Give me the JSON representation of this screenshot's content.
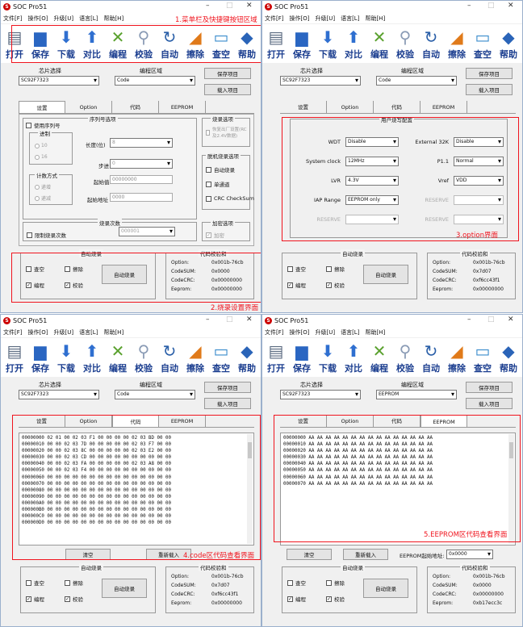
{
  "app": {
    "title": "SOC Pro51",
    "logo": "S"
  },
  "menu": [
    "文件[F]",
    "操作[O]",
    "升级[U]",
    "语言[L]",
    "帮助[H]"
  ],
  "toolbar": [
    {
      "label": "打开",
      "icon": "document-icon",
      "glyph": "▤",
      "color": "#5a6a80"
    },
    {
      "label": "保存",
      "icon": "floppy-icon",
      "glyph": "▆",
      "color": "#2a66c2"
    },
    {
      "label": "下载",
      "icon": "arrow-down-icon",
      "glyph": "⬇",
      "color": "#2f6fd0"
    },
    {
      "label": "对比",
      "icon": "arrow-up-icon",
      "glyph": "⬆",
      "color": "#2f6fd0"
    },
    {
      "label": "编程",
      "icon": "tools-icon",
      "glyph": "✕",
      "color": "#5aa12e"
    },
    {
      "label": "校验",
      "icon": "magnifier-icon",
      "glyph": "⚲",
      "color": "#8a9bb5"
    },
    {
      "label": "自动",
      "icon": "refresh-icon",
      "glyph": "↻",
      "color": "#2a5fa8"
    },
    {
      "label": "擦除",
      "icon": "eraser-icon",
      "glyph": "◢",
      "color": "#e07a1a"
    },
    {
      "label": "查空",
      "icon": "monitor-icon",
      "glyph": "▭",
      "color": "#3a8ccc"
    },
    {
      "label": "帮助",
      "icon": "help-icon",
      "glyph": "◆",
      "color": "#2a64b8"
    }
  ],
  "chip": {
    "label": "芯片选择",
    "value": "SC92F7323"
  },
  "region": {
    "label": "编程区域",
    "value_code": "Code",
    "value_eeprom": "EEPROM"
  },
  "buttons": {
    "save_project": "保存项目",
    "load_project": "载入项目",
    "clear": "清空",
    "reload": "重新载入",
    "auto_burn": "自动烧录"
  },
  "tabs": [
    "设置",
    "Option",
    "代码",
    "EEPROM"
  ],
  "settings": {
    "serial_check": "使用序列号",
    "base_label": "进制",
    "base_10": "10",
    "base_16": "16",
    "serial_options": "序列号选项",
    "length_label": "长度(位)",
    "length_value": "8",
    "step_label": "步进",
    "step_value": "0",
    "start_label": "起始值",
    "start_value": "00000000",
    "start_addr_label": "起始地址",
    "start_addr_value": "0000",
    "count_mode": "计数方式",
    "inc": "递增",
    "dec": "递减",
    "burn_options": "烧录选项",
    "burn_opt_text": "恢复出厂设置(RC 及2.4V数据)",
    "offline_options": "脱机烧录选项",
    "auto_burn_chk": "自动烧录",
    "single_ch": "单通道",
    "crc_chk": "CRC CheckSum",
    "burn_count": "烧录次数",
    "limit_count": "限制烧录次数",
    "count_value": "000001",
    "encrypt_options": "加密选项",
    "encrypt": "加密"
  },
  "option": {
    "title": "用户烧写配置",
    "wdt_label": "WDT",
    "wdt": "Disable",
    "ext_label": "External 32K",
    "ext": "Disable",
    "clk_label": "System clock",
    "clk": "12MHz",
    "p11_label": "P1.1",
    "p11": "Normal",
    "lvr_label": "LVR",
    "lvr": "4.3V",
    "vref_label": "Vref",
    "vref": "VDD",
    "iap_label": "IAP Range",
    "iap": "EEPROM only",
    "reserve": "RESERVE"
  },
  "auto_burn_group": {
    "title": "自动烧录",
    "blank": "查空",
    "erase": "擦除",
    "program": "编程",
    "verify": "校验"
  },
  "checksum_group": {
    "title": "代码校验和",
    "option_label": "Option:",
    "codesum_label": "CodeSUM:",
    "codecrc_label": "CodeCRC:",
    "eeprom_label": "Eeprom:",
    "w1": {
      "option": "0x001b-76cb",
      "codesum": "0x0000",
      "codecrc": "0x00000000",
      "eeprom": "0x00000000"
    },
    "w2": {
      "option": "0x001b-76cb",
      "codesum": "0x7d07",
      "codecrc": "0xf6cc43f1",
      "eeprom": "0x00000000"
    },
    "w3": {
      "option": "0x001b-76cb",
      "codesum": "0x7d07",
      "codecrc": "0xf6cc43f1",
      "eeprom": "0x00000000"
    },
    "w4": {
      "option": "0x001b-76cb",
      "codesum": "0x0000",
      "codecrc": "0x00000000",
      "eeprom": "0xb17ecc3c"
    }
  },
  "eeprom_addr_label": "EEPROM起始地址:",
  "eeprom_addr_value": "0x0000",
  "code_lines": [
    "00000000 02 01 00 02 03 F1 00 00 00 00 02 03 BD 00 00",
    "00000010 00 00 02 03 7D 00 00 00 00 00 02 03 F7 00 00",
    "00000020 00 00 02 03 8C 00 00 00 00 00 02 03 E2 00 00",
    "00000030 00 00 02 03 CD 00 00 00 00 00 00 00 00 00 00",
    "00000040 00 00 02 03 FA 00 00 00 00 00 02 03 A8 00 00",
    "00000050 00 00 02 03 F4 00 00 00 00 00 00 00 00 00 00",
    "00000060 00 00 00 00 00 00 00 00 00 00 00 00 00 00 00",
    "00000070 00 00 00 00 00 00 00 00 00 00 00 00 00 00 00",
    "00000080 00 00 00 00 00 00 00 00 00 00 00 00 00 00 00",
    "00000090 00 00 00 00 00 00 00 00 00 00 00 00 00 00 00",
    "000000A0 00 00 00 00 00 00 00 00 00 00 00 00 00 00 00",
    "000000B0 00 00 00 00 00 00 00 00 00 00 00 00 00 00 00",
    "000000C0 00 00 00 00 00 00 00 00 00 00 00 00 00 00 00",
    "000000D0 00 00 00 00 00 00 00 00 00 00 00 00 00 00 00"
  ],
  "eeprom_lines": [
    "00000000 AA AA AA AA AA AA AA AA AA AA AA AA AA AA AA",
    "00000010 AA AA AA AA AA AA AA AA AA AA AA AA AA AA AA",
    "00000020 AA AA AA AA AA AA AA AA AA AA AA AA AA AA AA",
    "00000030 AA AA AA AA AA AA AA AA AA AA AA AA AA AA AA",
    "00000040 AA AA AA AA AA AA AA AA AA AA AA AA AA AA AA",
    "00000050 AA AA AA AA AA AA AA AA AA AA AA AA AA AA AA",
    "00000060 AA AA AA AA AA AA AA AA AA AA AA AA AA AA AA",
    "00000070 AA AA AA AA AA AA AA AA AA AA AA AA AA AA AA"
  ],
  "annotations": {
    "a1": "1.菜单栏及快捷键按钮区域",
    "a2": "2.烧录设置界面",
    "a3": "3.option界面",
    "a4": "4.code区代码查看界面",
    "a5": "5.EEPROM区代码查看界面"
  },
  "colors": {
    "annotation": "#f0141e",
    "toolbar_text": "#1a3d8f"
  }
}
